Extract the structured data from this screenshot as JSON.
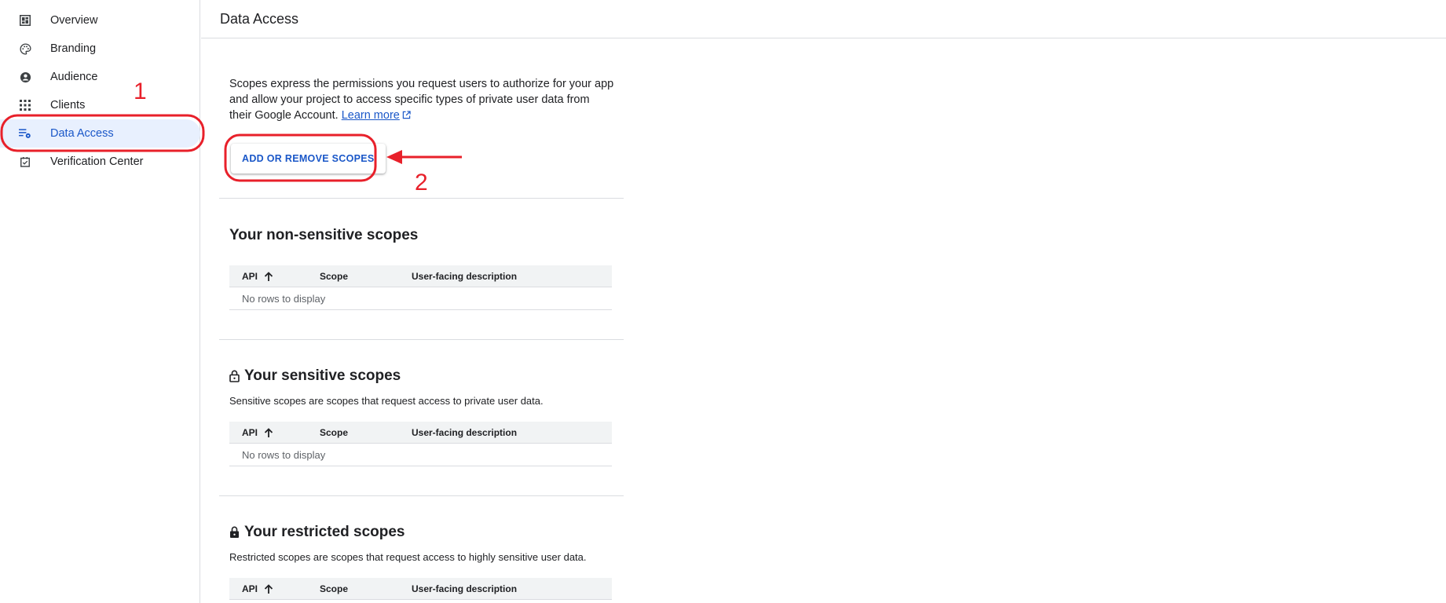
{
  "sidebar": {
    "items": [
      {
        "label": "Overview",
        "icon": "dashboard-icon",
        "active": false
      },
      {
        "label": "Branding",
        "icon": "palette-icon",
        "active": false
      },
      {
        "label": "Audience",
        "icon": "account-circle-icon",
        "active": false
      },
      {
        "label": "Clients",
        "icon": "apps-grid-icon",
        "active": false
      },
      {
        "label": "Data Access",
        "icon": "list-settings-icon",
        "active": true
      },
      {
        "label": "Verification Center",
        "icon": "checkbox-icon",
        "active": false
      }
    ]
  },
  "header": {
    "title": "Data Access"
  },
  "intro": {
    "text": "Scopes express the permissions you request users to authorize for your app and allow your project to access specific types of private user data from their Google Account.",
    "link": "Learn more"
  },
  "scopes_button": {
    "label": "ADD OR REMOVE SCOPES"
  },
  "sections": {
    "non_sensitive": {
      "title": "Your non-sensitive scopes",
      "columns": [
        "API",
        "Scope",
        "User-facing description"
      ],
      "empty": "No rows to display"
    },
    "sensitive": {
      "title": "Your sensitive scopes",
      "description": "Sensitive scopes are scopes that request access to private user data.",
      "columns": [
        "API",
        "Scope",
        "User-facing description"
      ],
      "empty": "No rows to display"
    },
    "restricted": {
      "title": "Your restricted scopes",
      "description": "Restricted scopes are scopes that request access to highly sensitive user data.",
      "columns": [
        "API",
        "Scope",
        "User-facing description"
      ]
    }
  },
  "annotations": {
    "step1": "1",
    "step2": "2",
    "color": "#e8202a"
  },
  "colors": {
    "accent": "#1a57c8",
    "active_bg": "#e8f0fe",
    "divider": "#dadce0"
  }
}
